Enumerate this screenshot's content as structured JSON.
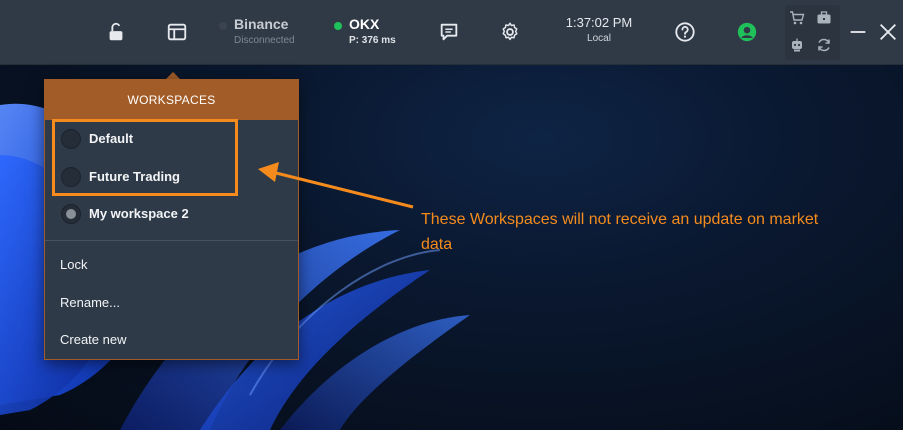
{
  "topbar": {
    "icons": {
      "lock": "unlock-icon",
      "workspaces": "workspaces-icon",
      "chat": "chat-icon",
      "settings": "gear-icon",
      "help": "help-icon",
      "account": "user-icon"
    },
    "exchanges": [
      {
        "name": "Binance",
        "status": "Disconnected",
        "dot_color": "#3a434e"
      },
      {
        "name": "OKX",
        "status": "P: 376 ms",
        "dot_color": "#1fc25a"
      }
    ],
    "clock": {
      "time": "1:37:02 PM",
      "zone": "Local"
    },
    "mini_icons": [
      "cart-icon",
      "briefcase-icon",
      "robot-icon",
      "refresh-icon"
    ],
    "window_controls": {
      "minimize": "minimize-icon",
      "close": "close-icon"
    }
  },
  "popup": {
    "title": "WORKSPACES",
    "items": [
      {
        "label": "Default",
        "selected": false
      },
      {
        "label": "Future Trading",
        "selected": false
      },
      {
        "label": "My workspace 2",
        "selected": true
      }
    ],
    "actions": [
      {
        "label": "Lock"
      },
      {
        "label": "Rename..."
      },
      {
        "label": "Create new"
      }
    ]
  },
  "annotation": {
    "text": "These Workspaces will not receive an update on market data",
    "color": "#f48b1c"
  },
  "colors": {
    "topbar_bg": "#303a46",
    "popup_bg": "#2f3a48",
    "popup_header": "#a25c28",
    "accent_green": "#1fc25a"
  }
}
